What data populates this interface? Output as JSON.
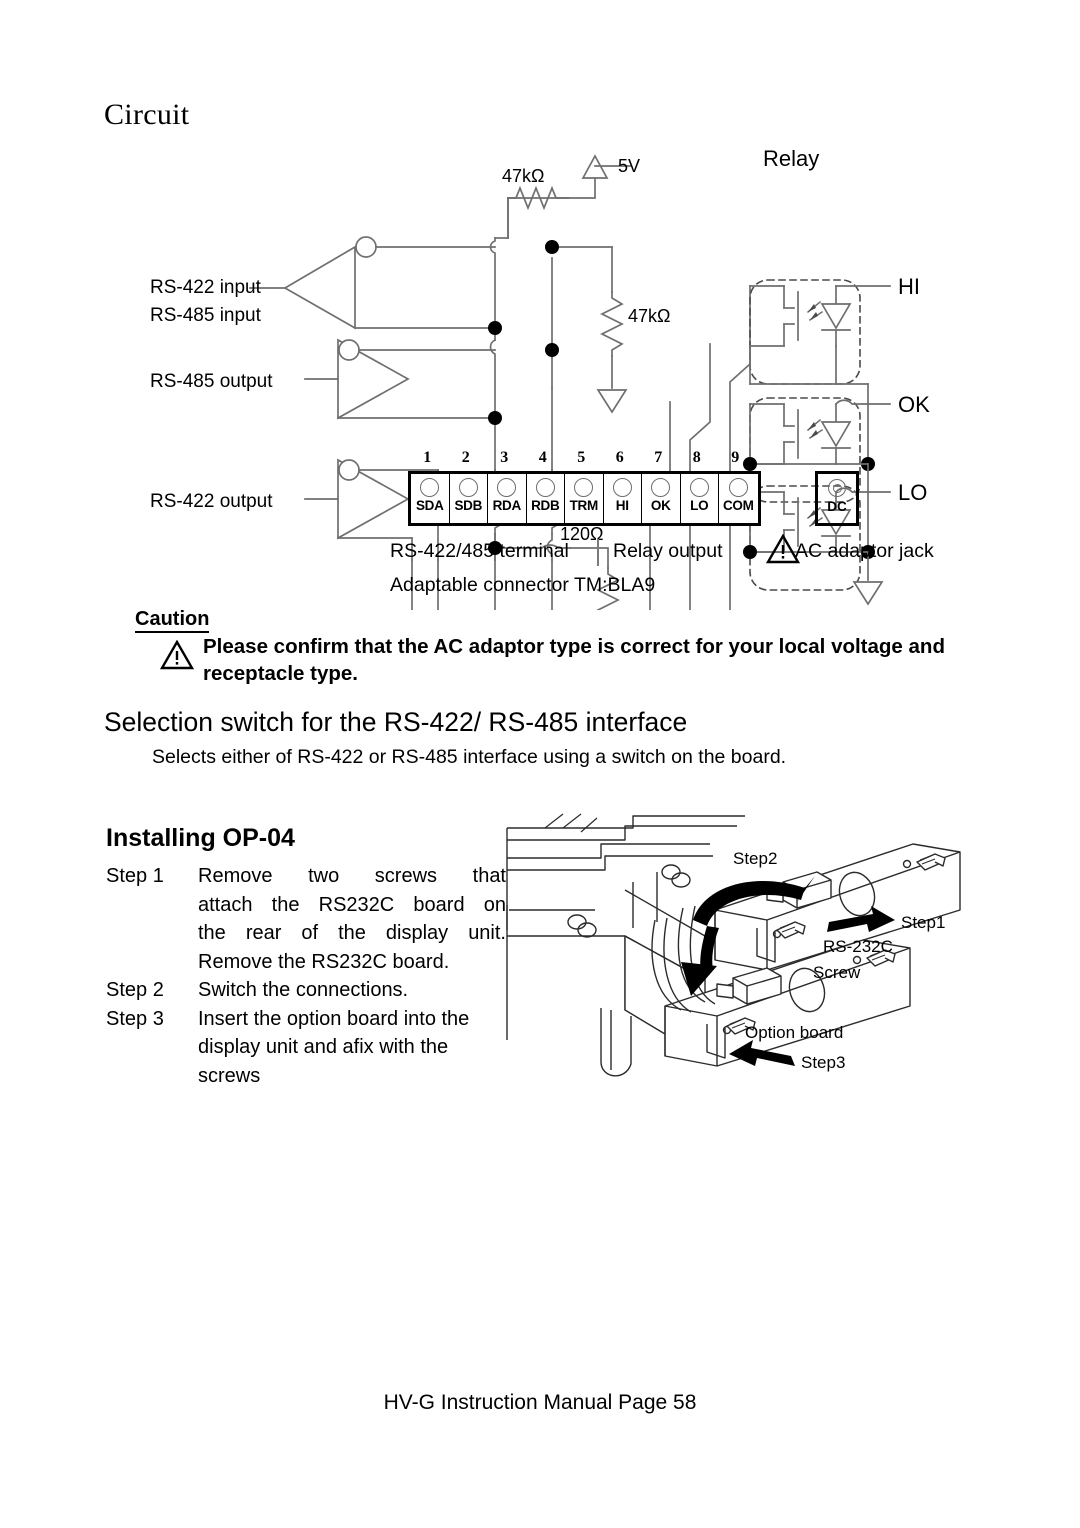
{
  "page": {
    "footer": "HV-G Instruction Manual Page 58"
  },
  "circuit": {
    "heading": "Circuit",
    "signal_labels": [
      "RS-422 input",
      "RS-485 input",
      "RS-485 output",
      "RS-422 output"
    ],
    "supply_label": "5V",
    "relay_group_label": "Relay",
    "relay_outputs": [
      "HI",
      "OK",
      "LO"
    ],
    "resistors": [
      {
        "name": "pullup-resistor",
        "value": "47kΩ"
      },
      {
        "name": "pulldown-resistor",
        "value": "47kΩ"
      },
      {
        "name": "bias-resistor-a",
        "value": "47kΩ"
      },
      {
        "name": "bias-resistor-b",
        "value": "47kΩ"
      },
      {
        "name": "termination-resistor",
        "value": "120Ω"
      }
    ],
    "terminal": {
      "numbers": [
        "1",
        "2",
        "3",
        "4",
        "5",
        "6",
        "7",
        "8",
        "9"
      ],
      "labels": [
        "SDA",
        "SDB",
        "RDA",
        "RDB",
        "TRM",
        "HI",
        "OK",
        "LO",
        "COM"
      ]
    },
    "dc_jack_label": "DC",
    "captions": {
      "rs_terminal": "RS-422/485 terminal",
      "relay_output": "Relay output",
      "ac_adaptor_jack": "AC adaptor jack",
      "adaptable_connector": "Adaptable connector TM:BLA9"
    }
  },
  "caution": {
    "title": "Caution",
    "text": "Please confirm that the AC adaptor type is correct for your local voltage and receptacle type."
  },
  "selection_switch": {
    "heading": "Selection switch for the RS-422/ RS-485 interface",
    "description": "Selects either of RS-422 or RS-485 interface using a switch on the board."
  },
  "installing": {
    "heading": "Installing OP-04",
    "steps": [
      {
        "label": "Step 1",
        "lines": [
          "Remove two screws that",
          "attach the RS232C board on",
          "the rear of the display unit.",
          "Remove the RS232C board."
        ]
      },
      {
        "label": "Step 2",
        "lines": [
          "Switch the connections."
        ]
      },
      {
        "label": "Step 3",
        "lines": [
          "Insert the option board into the",
          "display unit and afix with the",
          "screws"
        ]
      }
    ],
    "illustration_labels": {
      "step1": "Step1",
      "step2": "Step2",
      "step3": "Step3",
      "rs232c": "RS-232C",
      "screw": "Screw",
      "option_board": "Option board"
    }
  },
  "colors": {
    "ink": "#000000",
    "wire": "#6f6f6f",
    "node": "#000000"
  }
}
